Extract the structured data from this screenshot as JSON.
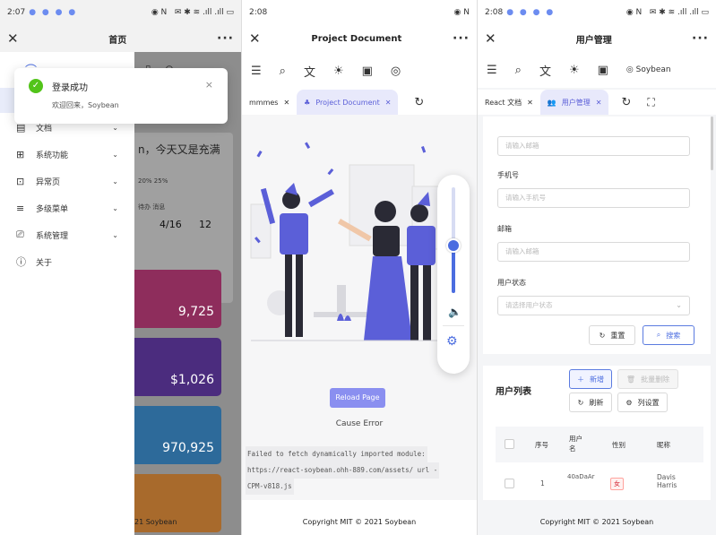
{
  "panel_home": {
    "status_time": "2:07",
    "title": "首页",
    "toast": {
      "title": "登录成功",
      "desc": "欢迎回来，Soybean",
      "close": "×"
    },
    "menu": [
      {
        "label": "文档",
        "icon": "document-icon",
        "chevron": true
      },
      {
        "label": "系统功能",
        "icon": "grid-icon",
        "chevron": true
      },
      {
        "label": "异常页",
        "icon": "error-page-icon",
        "chevron": true
      },
      {
        "label": "多级菜单",
        "icon": "menu-lines-icon",
        "chevron": true
      },
      {
        "label": "系统管理",
        "icon": "monitor-icon",
        "chevron": true
      },
      {
        "label": "关于",
        "icon": "info-icon",
        "chevron": false
      }
    ],
    "behind": {
      "greeting": "n，今天又是充满",
      "small1": "20%   25%",
      "small2": "待办      消息",
      "num1": "4/16",
      "num2": "12"
    },
    "stat_cards": [
      {
        "value": "9,725",
        "color": "#c43d82"
      },
      {
        "value": "$1,026",
        "color": "#6a3fb0"
      },
      {
        "value": "970,925",
        "color": "#3f8fd0"
      },
      {
        "value": "",
        "color": "#e8903a"
      }
    ],
    "footer": "21 Soybean"
  },
  "panel_doc": {
    "status_time": "2:08",
    "title": "Project Document",
    "tabs": [
      {
        "label": "mmmes",
        "active": false
      },
      {
        "label": "Project Document",
        "active": true
      }
    ],
    "reload_label": "Reload Page",
    "cause_label": "Cause Error",
    "error_lines": [
      "Failed to fetch dynamically imported module:",
      "https://react-soybean.ohh-889.com/assets/ url -",
      "CPM-v818.js"
    ],
    "volume_level": 0.45,
    "footer": "Copyright MIT © 2021 Soybean"
  },
  "panel_user": {
    "status_time": "2:08",
    "title": "用户管理",
    "tabs": [
      {
        "label": "React 文档",
        "active": false
      },
      {
        "label": "用户管理",
        "active": true
      }
    ],
    "form": {
      "field0_placeholder": "请输入邮箱",
      "phone_label": "手机号",
      "phone_placeholder": "请输入手机号",
      "email_label": "邮箱",
      "email_placeholder": "请输入邮箱",
      "status_label": "用户状态",
      "status_placeholder": "请选择用户状态",
      "reset_label": "重置",
      "search_label": "搜索"
    },
    "list": {
      "title": "用户列表",
      "add_label": "新增",
      "batch_delete_label": "批量删除",
      "refresh_label": "刷新",
      "columns_label": "列设置",
      "headers": [
        "序号",
        "用户名",
        "性别",
        "昵称"
      ],
      "rows": [
        {
          "index": "1",
          "username": "40aDaAr",
          "gender": "女",
          "nickname": "Davis Harris"
        }
      ]
    },
    "footer": "Copyright MIT © 2021 Soybean"
  }
}
